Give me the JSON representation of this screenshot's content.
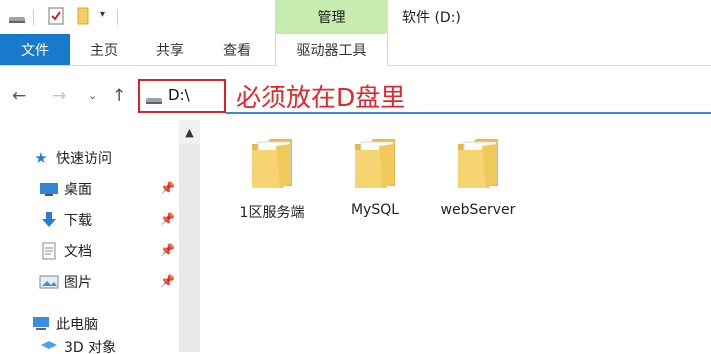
{
  "title_bar": {
    "context_tab": "管理",
    "window_title": "软件 (D:)",
    "qat_icons": [
      "drive-icon",
      "properties-check-icon",
      "new-folder-icon",
      "customize-dropdown-icon"
    ]
  },
  "ribbon": {
    "tabs": [
      "文件",
      "主页",
      "共享",
      "查看"
    ],
    "context_tab_label": "驱动器工具"
  },
  "address": {
    "path": "D:\\",
    "annotation": "必须放在D盘里"
  },
  "nav": {
    "quick_access": "快速访问",
    "items": [
      {
        "label": "桌面",
        "icon": "desktop-icon"
      },
      {
        "label": "下载",
        "icon": "download-icon"
      },
      {
        "label": "文档",
        "icon": "document-icon"
      },
      {
        "label": "图片",
        "icon": "pictures-icon"
      }
    ],
    "this_pc": "此电脑",
    "partial_item": "3D 对象"
  },
  "folders": [
    {
      "name": "1区服务端"
    },
    {
      "name": "MySQL"
    },
    {
      "name": "webServer"
    }
  ],
  "colors": {
    "accent": "#1979ca",
    "context_green": "#c6ecb0",
    "annotation_red": "#e3262d",
    "folder_yellow": "#f4cf63"
  }
}
